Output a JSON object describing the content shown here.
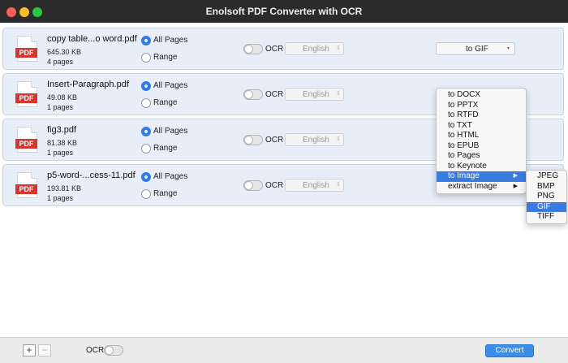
{
  "window": {
    "title": "Enolsoft PDF Converter with OCR"
  },
  "files": [
    {
      "name": "copy table...o word.pdf",
      "size": "645.30 KB",
      "pages": "4 pages",
      "page_mode": "All Pages",
      "ocr_label": "OCR",
      "language": "English",
      "format": "to GIF"
    },
    {
      "name": "Insert-Paragraph.pdf",
      "size": "49.08 KB",
      "pages": "1 pages",
      "page_mode": "All Pages",
      "ocr_label": "OCR",
      "language": "English"
    },
    {
      "name": "fig3.pdf",
      "size": "81.38 KB",
      "pages": "1 pages",
      "page_mode": "All Pages",
      "ocr_label": "OCR",
      "language": "English"
    },
    {
      "name": "p5-word-...cess-11.pdf",
      "size": "193.81 KB",
      "pages": "1 pages",
      "page_mode": "All Pages",
      "ocr_label": "OCR",
      "language": "English"
    }
  ],
  "labels": {
    "all_pages": "All Pages",
    "range": "Range",
    "pdf_badge": "PDF"
  },
  "format_menu": {
    "items": [
      "to DOCX",
      "to PPTX",
      "to RTFD",
      "to TXT",
      "to HTML",
      "to EPUB",
      "to Pages",
      "to Keynote",
      "to Image",
      "extract Image"
    ],
    "highlighted": "to Image",
    "submenu_arrow": "▶"
  },
  "image_submenu": {
    "items": [
      "JPEG",
      "BMP",
      "PNG",
      "GIF",
      "TIFF"
    ],
    "highlighted": "GIF"
  },
  "bottom_bar": {
    "add_label": "+",
    "remove_label": "−",
    "ocr_label": "OCR",
    "convert_label": "Convert"
  },
  "icons": {
    "dropdown_arrow": "▾",
    "updown_arrow": "⇕"
  },
  "colors": {
    "accent": "#3a7be0",
    "pdf_badge": "#d9352b",
    "row_bg": "#e8eef8"
  }
}
